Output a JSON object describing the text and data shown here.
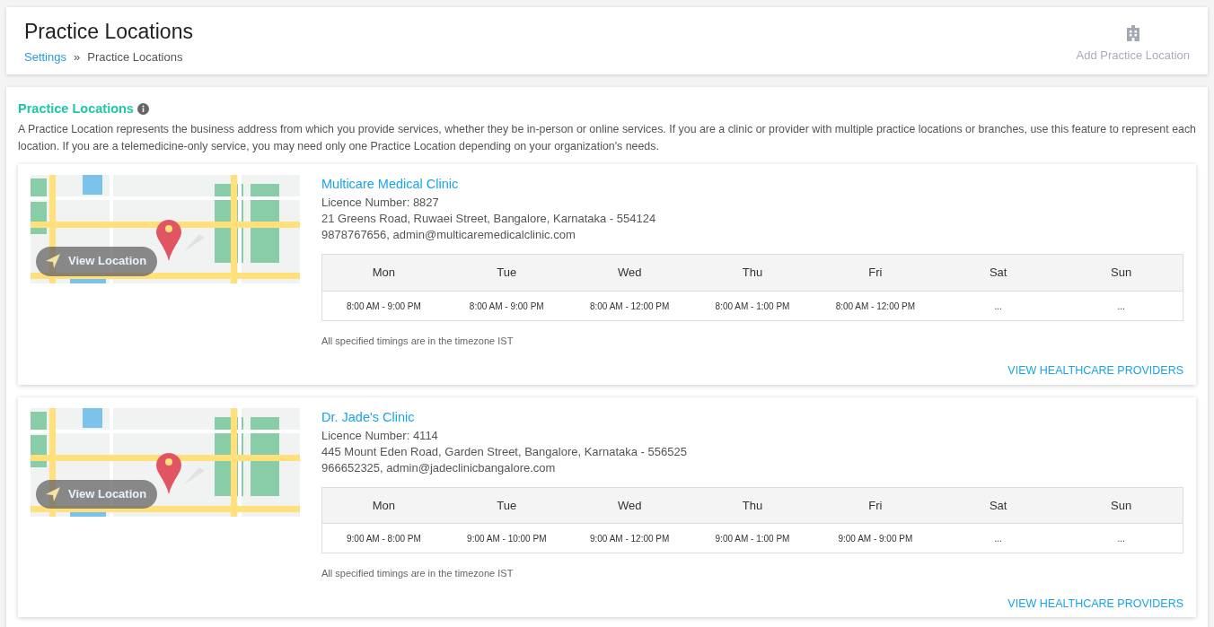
{
  "header": {
    "title": "Practice Locations",
    "breadcrumb": [
      "Settings",
      "Practice Locations"
    ],
    "breadcrumb_separator": "»",
    "add_button": "Add Practice Location"
  },
  "section": {
    "title": "Practice Locations",
    "description": "A Practice Location represents the business address from which you provide services, whether they be in-person or online services. If you are a clinic or provider with multiple practice locations or branches, use this feature to represent each location. If you are a telemedicine-only service, you may need only one Practice Location depending on your organization's needs."
  },
  "locations": [
    {
      "map_button": "View Location",
      "name": "Multicare Medical Clinic",
      "licence": "Licence Number: 8827",
      "address": "21 Greens Road, Ruwaei Street, Bangalore, Karnataka - 554124",
      "contact": "9878767656, admin@multicaremedicalclinic.com",
      "days": [
        "Mon",
        "Tue",
        "Wed",
        "Thu",
        "Fri",
        "Sat",
        "Sun"
      ],
      "hours": [
        "8:00 AM - 9:00 PM",
        "8:00 AM - 9:00 PM",
        "8:00 AM - 12:00 PM",
        "8:00 AM - 1:00 PM",
        "8:00 AM - 12:00 PM",
        "...",
        "..."
      ],
      "timezone_note": "All specified timings are in the timezone IST",
      "providers_link": "VIEW HEALTHCARE PROVIDERS"
    },
    {
      "map_button": "View Location",
      "name": "Dr. Jade's Clinic",
      "licence": "Licence Number: 4114",
      "address": "445 Mount Eden Road, Garden Street, Bangalore, Karnataka - 556525",
      "contact": "966652325, admin@jadeclinicbangalore.com",
      "days": [
        "Mon",
        "Tue",
        "Wed",
        "Thu",
        "Fri",
        "Sat",
        "Sun"
      ],
      "hours": [
        "9:00 AM - 8:00 PM",
        "9:00 AM - 10:00 PM",
        "9:00 AM - 12:00 PM",
        "9:00 AM - 1:00 PM",
        "9:00 AM - 9:00 PM",
        "...",
        "..."
      ],
      "timezone_note": "All specified timings are in the timezone IST",
      "providers_link": "VIEW HEALTHCARE PROVIDERS"
    }
  ]
}
